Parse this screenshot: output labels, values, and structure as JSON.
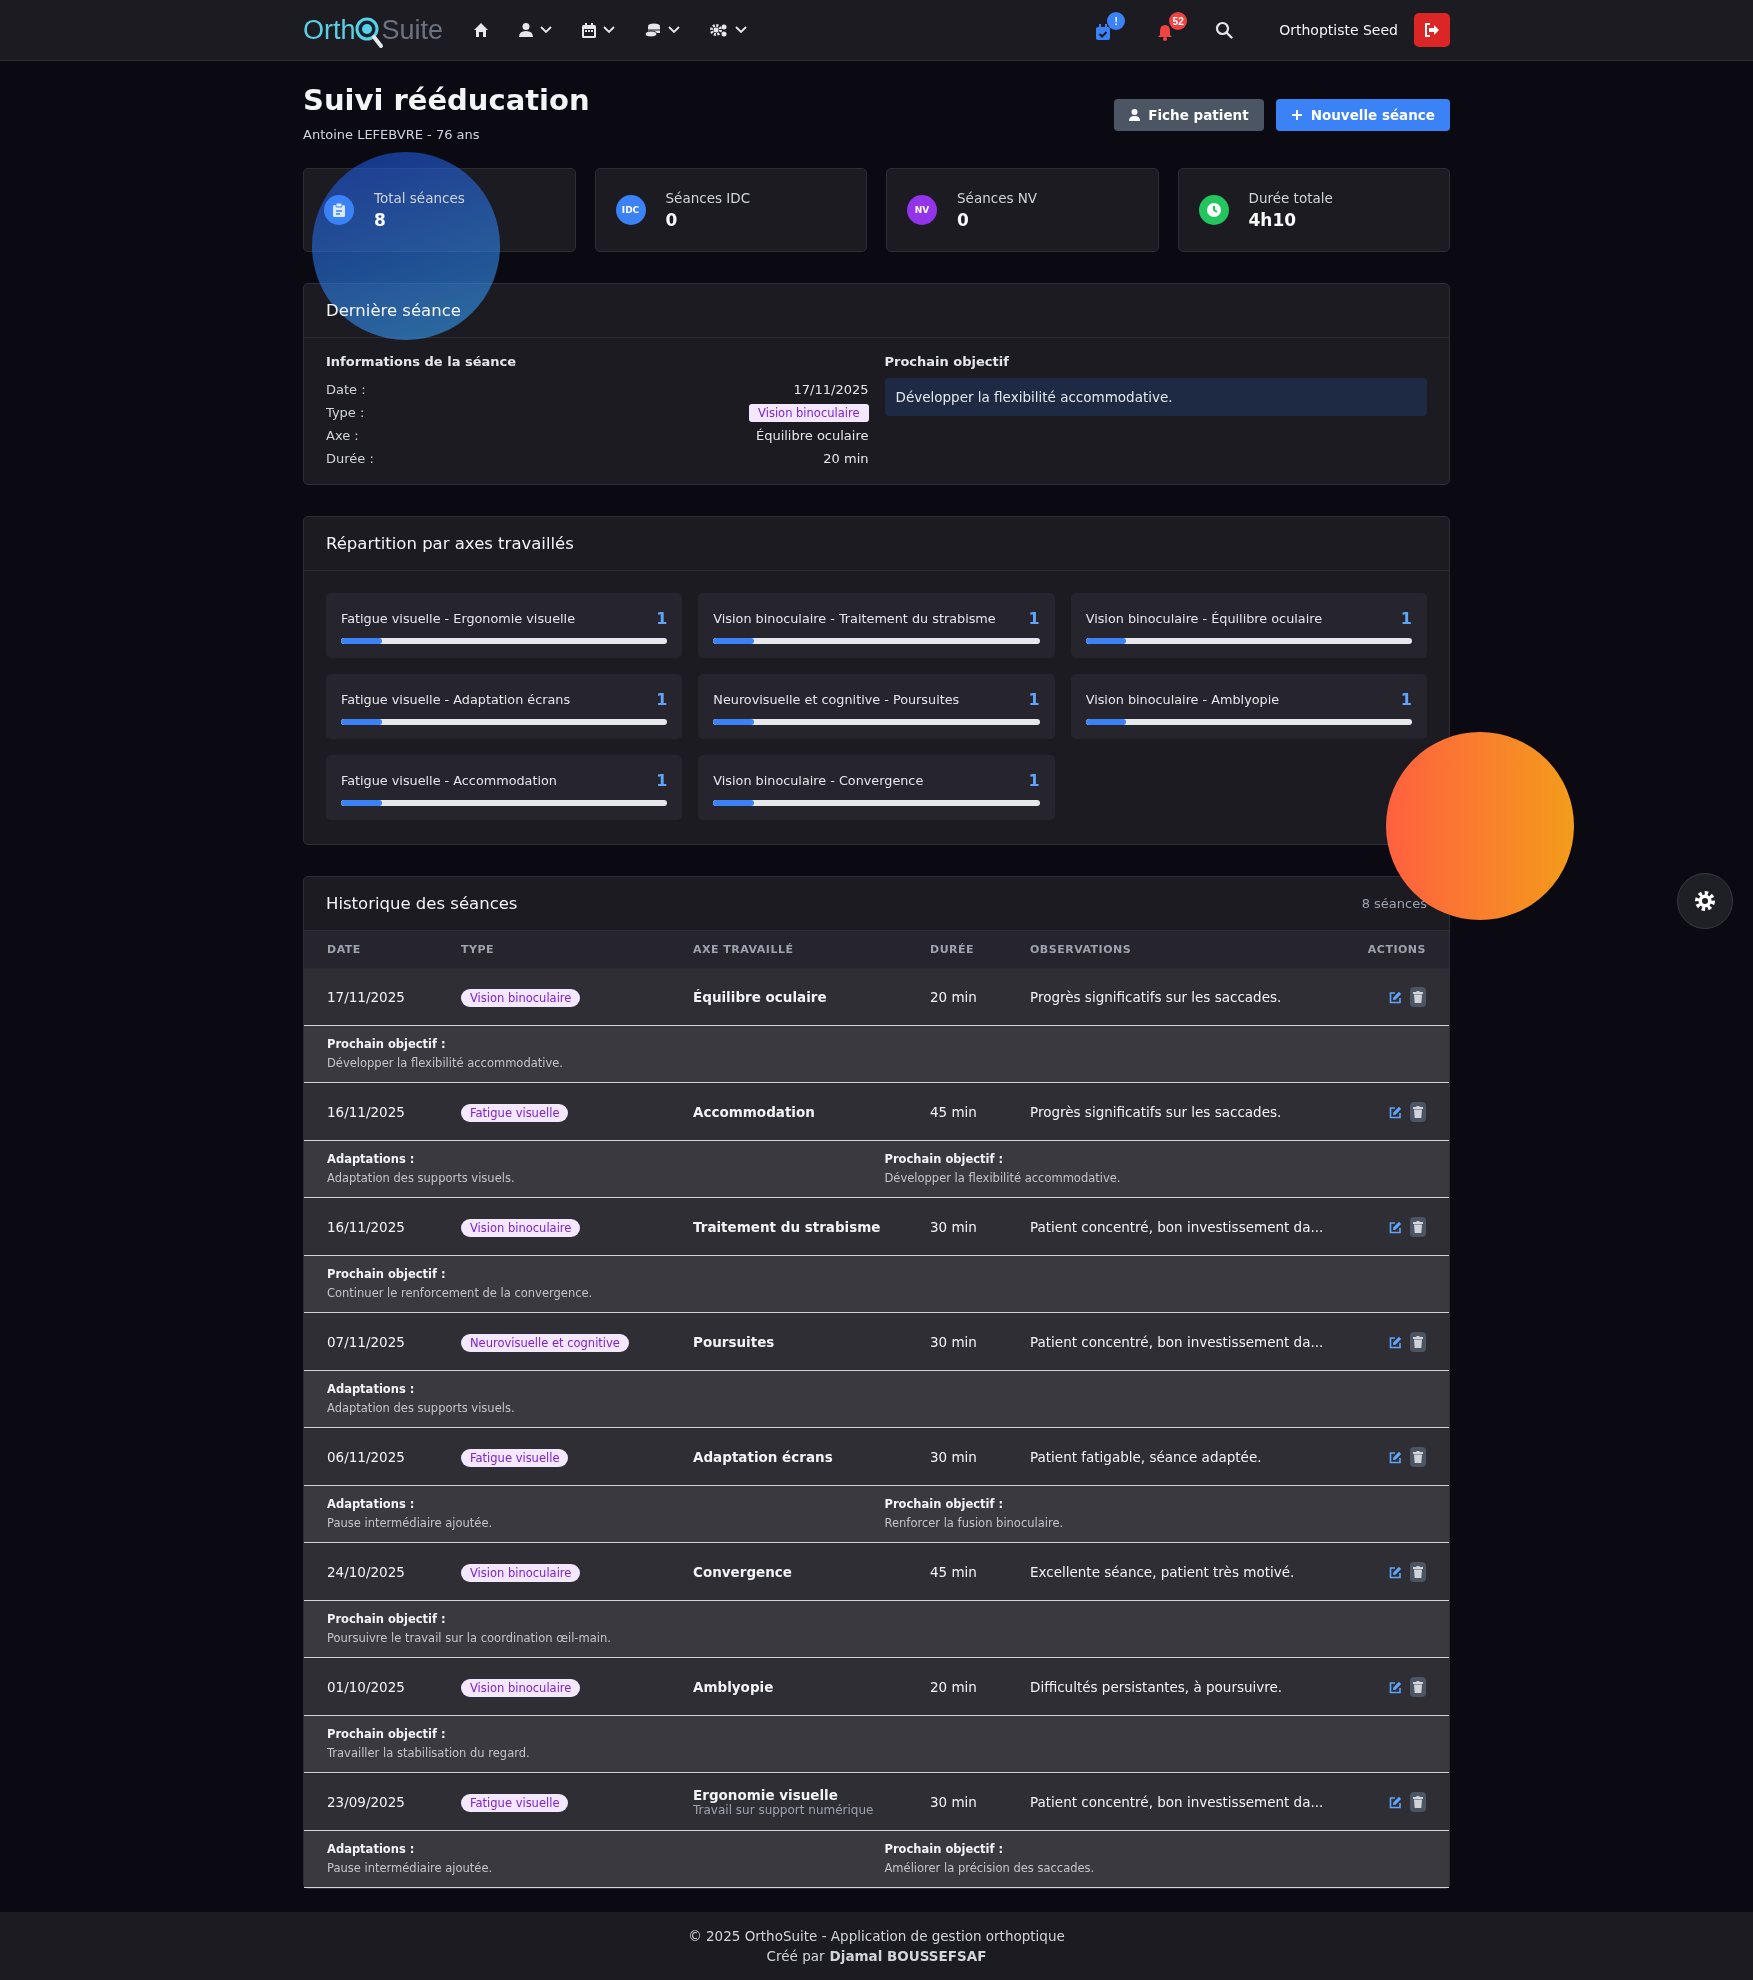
{
  "navbar": {
    "logo_start": "Orth",
    "logo_end": "Suite",
    "nav_items": [
      {
        "kind": "home",
        "dropdown": false
      },
      {
        "kind": "user",
        "dropdown": true
      },
      {
        "kind": "calendar",
        "dropdown": true
      },
      {
        "kind": "coins",
        "dropdown": true
      },
      {
        "kind": "gears",
        "dropdown": true
      }
    ],
    "alerts": [
      {
        "kind": "calendar",
        "badge": "!",
        "color": "#3b82f6"
      },
      {
        "kind": "bell",
        "badge": "52",
        "color": "#ef4444"
      }
    ],
    "user": "Orthoptiste Seed"
  },
  "header": {
    "title": "Suivi rééducation",
    "subtitle": "Antoine LEFEBVRE - 76 ans",
    "buttons": [
      {
        "label": "Fiche patient",
        "kind": "secondary"
      },
      {
        "label": "Nouvelle séance",
        "kind": "primary"
      }
    ]
  },
  "stats": [
    {
      "label": "Total séances",
      "value": "8",
      "kind": "clipboard",
      "color": "#3b82f6"
    },
    {
      "label": "Séances IDC",
      "value": "0",
      "kind": "text",
      "badge": "IDC",
      "color": "#3b82f6"
    },
    {
      "label": "Séances NV",
      "value": "0",
      "kind": "text",
      "badge": "NV",
      "color": "#9333ea"
    },
    {
      "label": "Durée totale",
      "value": "4h10",
      "kind": "clock",
      "color": "#22c55e"
    }
  ],
  "last_session": {
    "title": "Dernière séance",
    "info_title": "Informations de la séance",
    "fields": [
      {
        "label": "Date :",
        "value": "17/11/2025",
        "kind": "text"
      },
      {
        "label": "Type :",
        "value": "Vision binoculaire",
        "kind": "tag"
      },
      {
        "label": "Axe :",
        "value": "Équilibre oculaire",
        "kind": "text"
      },
      {
        "label": "Durée :",
        "value": "20 min",
        "kind": "text"
      }
    ],
    "objective_title": "Prochain objectif",
    "objective": "Développer la flexibilité accommodative."
  },
  "distribution": {
    "title": "Répartition par axes travaillés",
    "items": [
      {
        "label": "Fatigue visuelle - Ergonomie visuelle",
        "count": "1",
        "level": 0.125
      },
      {
        "label": "Vision binoculaire - Traitement du strabisme",
        "count": "1",
        "level": 0.125
      },
      {
        "label": "Vision binoculaire - Équilibre oculaire",
        "count": "1",
        "level": 0.125
      },
      {
        "label": "Fatigue visuelle - Adaptation écrans",
        "count": "1",
        "level": 0.125
      },
      {
        "label": "Neurovisuelle et cognitive - Poursuites",
        "count": "1",
        "level": 0.125
      },
      {
        "label": "Vision binoculaire - Amblyopie",
        "count": "1",
        "level": 0.125
      },
      {
        "label": "Fatigue visuelle - Accommodation",
        "count": "1",
        "level": 0.125
      },
      {
        "label": "Vision binoculaire - Convergence",
        "count": "1",
        "level": 0.125
      }
    ]
  },
  "history": {
    "title": "Historique des séances",
    "count": "8 séances",
    "columns": [
      "DATE",
      "TYPE",
      "AXE TRAVAILLÉ",
      "DURÉE",
      "OBSERVATIONS",
      "ACTIONS"
    ],
    "rows": [
      {
        "date": "17/11/2025",
        "type": "Vision binoculaire",
        "axis": "Équilibre oculaire",
        "duration": "20 min",
        "observations": "Progrès significatifs sur les saccades.",
        "details": [
          {
            "label": "Prochain objectif :",
            "text": "Développer la flexibilité accommodative."
          }
        ]
      },
      {
        "date": "16/11/2025",
        "type": "Fatigue visuelle",
        "axis": "Accommodation",
        "duration": "45 min",
        "observations": "Progrès significatifs sur les saccades.",
        "details": [
          {
            "label": "Adaptations :",
            "text": "Adaptation des supports visuels."
          },
          {
            "label": "Prochain objectif :",
            "text": "Développer la flexibilité accommodative."
          }
        ]
      },
      {
        "date": "16/11/2025",
        "type": "Vision binoculaire",
        "axis": "Traitement du strabisme",
        "duration": "30 min",
        "observations": "Patient concentré, bon investissement da...",
        "details": [
          {
            "label": "Prochain objectif :",
            "text": "Continuer le renforcement de la convergence."
          }
        ]
      },
      {
        "date": "07/11/2025",
        "type": "Neurovisuelle et cognitive",
        "axis": "Poursuites",
        "duration": "30 min",
        "observations": "Patient concentré, bon investissement da...",
        "details": [
          {
            "label": "Adaptations :",
            "text": "Adaptation des supports visuels."
          }
        ]
      },
      {
        "date": "06/11/2025",
        "type": "Fatigue visuelle",
        "axis": "Adaptation écrans",
        "duration": "30 min",
        "observations": "Patient fatigable, séance adaptée.",
        "details": [
          {
            "label": "Adaptations :",
            "text": "Pause intermédiaire ajoutée."
          },
          {
            "label": "Prochain objectif :",
            "text": "Renforcer la fusion binoculaire."
          }
        ]
      },
      {
        "date": "24/10/2025",
        "type": "Vision binoculaire",
        "axis": "Convergence",
        "duration": "45 min",
        "observations": "Excellente séance, patient très motivé.",
        "details": [
          {
            "label": "Prochain objectif :",
            "text": "Poursuivre le travail sur la coordination œil-main."
          }
        ]
      },
      {
        "date": "01/10/2025",
        "type": "Vision binoculaire",
        "axis": "Amblyopie",
        "duration": "20 min",
        "observations": "Difficultés persistantes, à poursuivre.",
        "details": [
          {
            "label": "Prochain objectif :",
            "text": "Travailler la stabilisation du regard."
          }
        ]
      },
      {
        "date": "23/09/2025",
        "type": "Fatigue visuelle",
        "axis": "Ergonomie visuelle",
        "axis_note": "Travail sur support numérique",
        "duration": "30 min",
        "observations": "Patient concentré, bon investissement da...",
        "details": [
          {
            "label": "Adaptations :",
            "text": "Pause intermédiaire ajoutée."
          },
          {
            "label": "Prochain objectif :",
            "text": "Améliorer la précision des saccades."
          }
        ]
      }
    ]
  },
  "footer": {
    "line1": "© 2025 OrthoSuite - Application de gestion orthoptique",
    "line2_prefix": "Créé par",
    "author": "Djamal BOUSSEFSAF"
  }
}
